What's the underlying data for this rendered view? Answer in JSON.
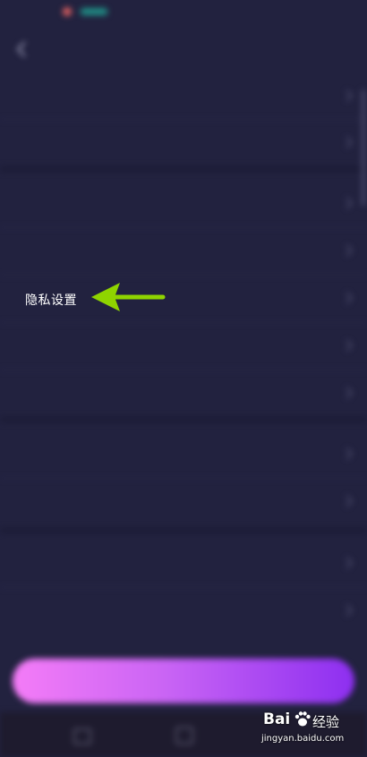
{
  "highlight": {
    "privacy_label": "隐私设置"
  },
  "watermark": {
    "logo_text": "Bai",
    "logo_suffix": "经验",
    "url": "jingyan.baidu.com"
  },
  "colors": {
    "background": "#22223f",
    "arrow": "#8fd400",
    "button_start": "#f47cf7",
    "button_end": "#8d2ff0"
  },
  "icons": {
    "back": "chevron-left-icon",
    "row_chevron": "chevron-right-icon",
    "pointer": "arrow-left-icon",
    "watermark_paw": "paw-icon"
  }
}
